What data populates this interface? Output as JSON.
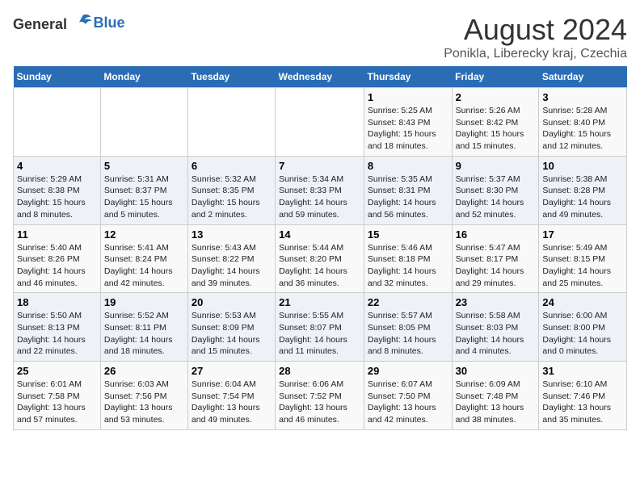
{
  "logo": {
    "general": "General",
    "blue": "Blue"
  },
  "title": "August 2024",
  "subtitle": "Ponikla, Liberecky kraj, Czechia",
  "days_of_week": [
    "Sunday",
    "Monday",
    "Tuesday",
    "Wednesday",
    "Thursday",
    "Friday",
    "Saturday"
  ],
  "weeks": [
    [
      {
        "day": "",
        "info": ""
      },
      {
        "day": "",
        "info": ""
      },
      {
        "day": "",
        "info": ""
      },
      {
        "day": "",
        "info": ""
      },
      {
        "day": "1",
        "info": "Sunrise: 5:25 AM\nSunset: 8:43 PM\nDaylight: 15 hours\nand 18 minutes."
      },
      {
        "day": "2",
        "info": "Sunrise: 5:26 AM\nSunset: 8:42 PM\nDaylight: 15 hours\nand 15 minutes."
      },
      {
        "day": "3",
        "info": "Sunrise: 5:28 AM\nSunset: 8:40 PM\nDaylight: 15 hours\nand 12 minutes."
      }
    ],
    [
      {
        "day": "4",
        "info": "Sunrise: 5:29 AM\nSunset: 8:38 PM\nDaylight: 15 hours\nand 8 minutes."
      },
      {
        "day": "5",
        "info": "Sunrise: 5:31 AM\nSunset: 8:37 PM\nDaylight: 15 hours\nand 5 minutes."
      },
      {
        "day": "6",
        "info": "Sunrise: 5:32 AM\nSunset: 8:35 PM\nDaylight: 15 hours\nand 2 minutes."
      },
      {
        "day": "7",
        "info": "Sunrise: 5:34 AM\nSunset: 8:33 PM\nDaylight: 14 hours\nand 59 minutes."
      },
      {
        "day": "8",
        "info": "Sunrise: 5:35 AM\nSunset: 8:31 PM\nDaylight: 14 hours\nand 56 minutes."
      },
      {
        "day": "9",
        "info": "Sunrise: 5:37 AM\nSunset: 8:30 PM\nDaylight: 14 hours\nand 52 minutes."
      },
      {
        "day": "10",
        "info": "Sunrise: 5:38 AM\nSunset: 8:28 PM\nDaylight: 14 hours\nand 49 minutes."
      }
    ],
    [
      {
        "day": "11",
        "info": "Sunrise: 5:40 AM\nSunset: 8:26 PM\nDaylight: 14 hours\nand 46 minutes."
      },
      {
        "day": "12",
        "info": "Sunrise: 5:41 AM\nSunset: 8:24 PM\nDaylight: 14 hours\nand 42 minutes."
      },
      {
        "day": "13",
        "info": "Sunrise: 5:43 AM\nSunset: 8:22 PM\nDaylight: 14 hours\nand 39 minutes."
      },
      {
        "day": "14",
        "info": "Sunrise: 5:44 AM\nSunset: 8:20 PM\nDaylight: 14 hours\nand 36 minutes."
      },
      {
        "day": "15",
        "info": "Sunrise: 5:46 AM\nSunset: 8:18 PM\nDaylight: 14 hours\nand 32 minutes."
      },
      {
        "day": "16",
        "info": "Sunrise: 5:47 AM\nSunset: 8:17 PM\nDaylight: 14 hours\nand 29 minutes."
      },
      {
        "day": "17",
        "info": "Sunrise: 5:49 AM\nSunset: 8:15 PM\nDaylight: 14 hours\nand 25 minutes."
      }
    ],
    [
      {
        "day": "18",
        "info": "Sunrise: 5:50 AM\nSunset: 8:13 PM\nDaylight: 14 hours\nand 22 minutes."
      },
      {
        "day": "19",
        "info": "Sunrise: 5:52 AM\nSunset: 8:11 PM\nDaylight: 14 hours\nand 18 minutes."
      },
      {
        "day": "20",
        "info": "Sunrise: 5:53 AM\nSunset: 8:09 PM\nDaylight: 14 hours\nand 15 minutes."
      },
      {
        "day": "21",
        "info": "Sunrise: 5:55 AM\nSunset: 8:07 PM\nDaylight: 14 hours\nand 11 minutes."
      },
      {
        "day": "22",
        "info": "Sunrise: 5:57 AM\nSunset: 8:05 PM\nDaylight: 14 hours\nand 8 minutes."
      },
      {
        "day": "23",
        "info": "Sunrise: 5:58 AM\nSunset: 8:03 PM\nDaylight: 14 hours\nand 4 minutes."
      },
      {
        "day": "24",
        "info": "Sunrise: 6:00 AM\nSunset: 8:00 PM\nDaylight: 14 hours\nand 0 minutes."
      }
    ],
    [
      {
        "day": "25",
        "info": "Sunrise: 6:01 AM\nSunset: 7:58 PM\nDaylight: 13 hours\nand 57 minutes."
      },
      {
        "day": "26",
        "info": "Sunrise: 6:03 AM\nSunset: 7:56 PM\nDaylight: 13 hours\nand 53 minutes."
      },
      {
        "day": "27",
        "info": "Sunrise: 6:04 AM\nSunset: 7:54 PM\nDaylight: 13 hours\nand 49 minutes."
      },
      {
        "day": "28",
        "info": "Sunrise: 6:06 AM\nSunset: 7:52 PM\nDaylight: 13 hours\nand 46 minutes."
      },
      {
        "day": "29",
        "info": "Sunrise: 6:07 AM\nSunset: 7:50 PM\nDaylight: 13 hours\nand 42 minutes."
      },
      {
        "day": "30",
        "info": "Sunrise: 6:09 AM\nSunset: 7:48 PM\nDaylight: 13 hours\nand 38 minutes."
      },
      {
        "day": "31",
        "info": "Sunrise: 6:10 AM\nSunset: 7:46 PM\nDaylight: 13 hours\nand 35 minutes."
      }
    ]
  ]
}
